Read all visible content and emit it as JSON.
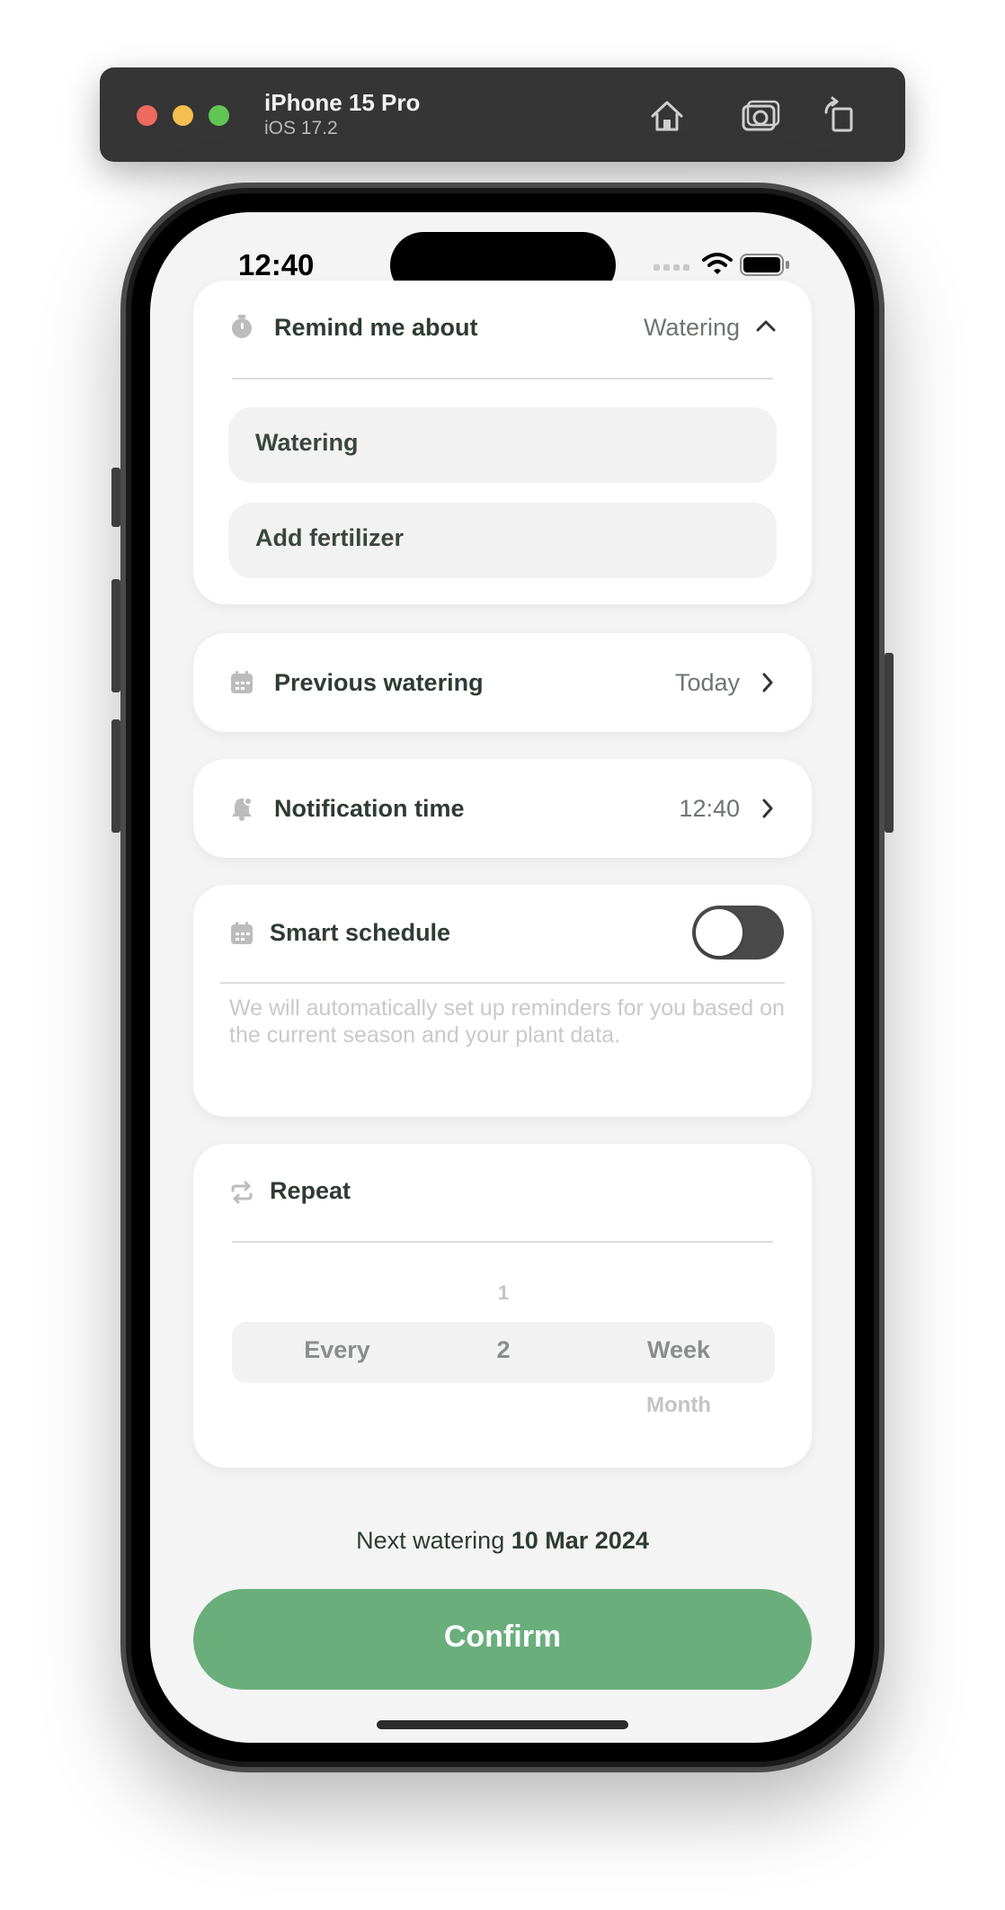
{
  "simulator": {
    "device_name": "iPhone 15 Pro",
    "os_version": "iOS 17.2",
    "traffic_light_colors": [
      "#ed6a5e",
      "#f4bf4f",
      "#61c554"
    ]
  },
  "status_bar": {
    "time": "12:40"
  },
  "remind": {
    "label": "Remind me about",
    "value": "Watering",
    "options": [
      "Watering",
      "Add fertilizer"
    ]
  },
  "previous_watering": {
    "label": "Previous watering",
    "value": "Today"
  },
  "notification_time": {
    "label": "Notification time",
    "value": "12:40"
  },
  "smart_schedule": {
    "label": "Smart schedule",
    "enabled": false,
    "description": "We will automatically set up reminders for you based on the current season and your plant data."
  },
  "repeat": {
    "label": "Repeat",
    "picker": {
      "col1_selected": "Every",
      "col2_above": "1",
      "col2_selected": "2",
      "col3_selected": "Week",
      "col3_below": "Month"
    }
  },
  "next_watering": {
    "prefix": "Next watering",
    "date": "10 Mar 2024"
  },
  "confirm_label": "Confirm",
  "colors": {
    "accent": "#6aae7c",
    "text_dark": "#2f3b33",
    "icon_gray": "#bcbcbc"
  }
}
